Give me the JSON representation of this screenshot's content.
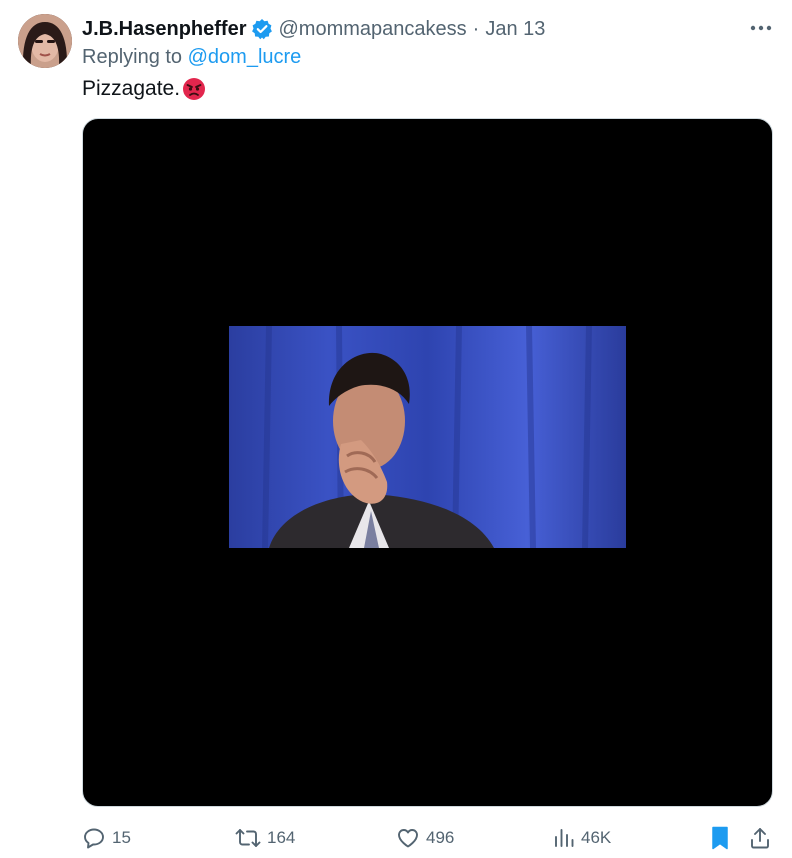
{
  "tweet": {
    "author_name": "J.B.Hasenpheffer",
    "handle": "@mommapancakess",
    "separator": "·",
    "date": "Jan 13",
    "reply_prefix": "Replying to ",
    "reply_to": "@dom_lucre",
    "text": "Pizzagate.",
    "emoji": "angry-face"
  },
  "actions": {
    "replies": "15",
    "retweets": "164",
    "likes": "496",
    "views": "46K"
  },
  "colors": {
    "accent": "#1d9bf0",
    "secondary_text": "#536471",
    "primary_text": "#0f1419",
    "media_background": "#000000"
  },
  "icons": [
    "more-icon",
    "verified-badge-icon",
    "reply-icon",
    "retweet-icon",
    "like-icon",
    "views-icon",
    "bookmark-icon",
    "share-icon"
  ]
}
